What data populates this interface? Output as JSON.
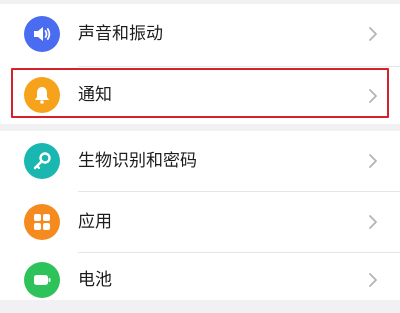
{
  "settings": {
    "items": [
      {
        "label": "声音和振动",
        "icon": "speaker-icon",
        "color": "#4a6cf0"
      },
      {
        "label": "通知",
        "icon": "bell-icon",
        "color": "#f7a21b",
        "highlighted": true
      },
      {
        "label": "生物识别和密码",
        "icon": "key-icon",
        "color": "#19b7b0"
      },
      {
        "label": "应用",
        "icon": "apps-grid-icon",
        "color": "#f58a1f"
      },
      {
        "label": "电池",
        "icon": "battery-icon",
        "color": "#2ec25a"
      }
    ]
  },
  "colors": {
    "highlight_border": "#d6202a",
    "chevron": "#b3b3b3"
  }
}
